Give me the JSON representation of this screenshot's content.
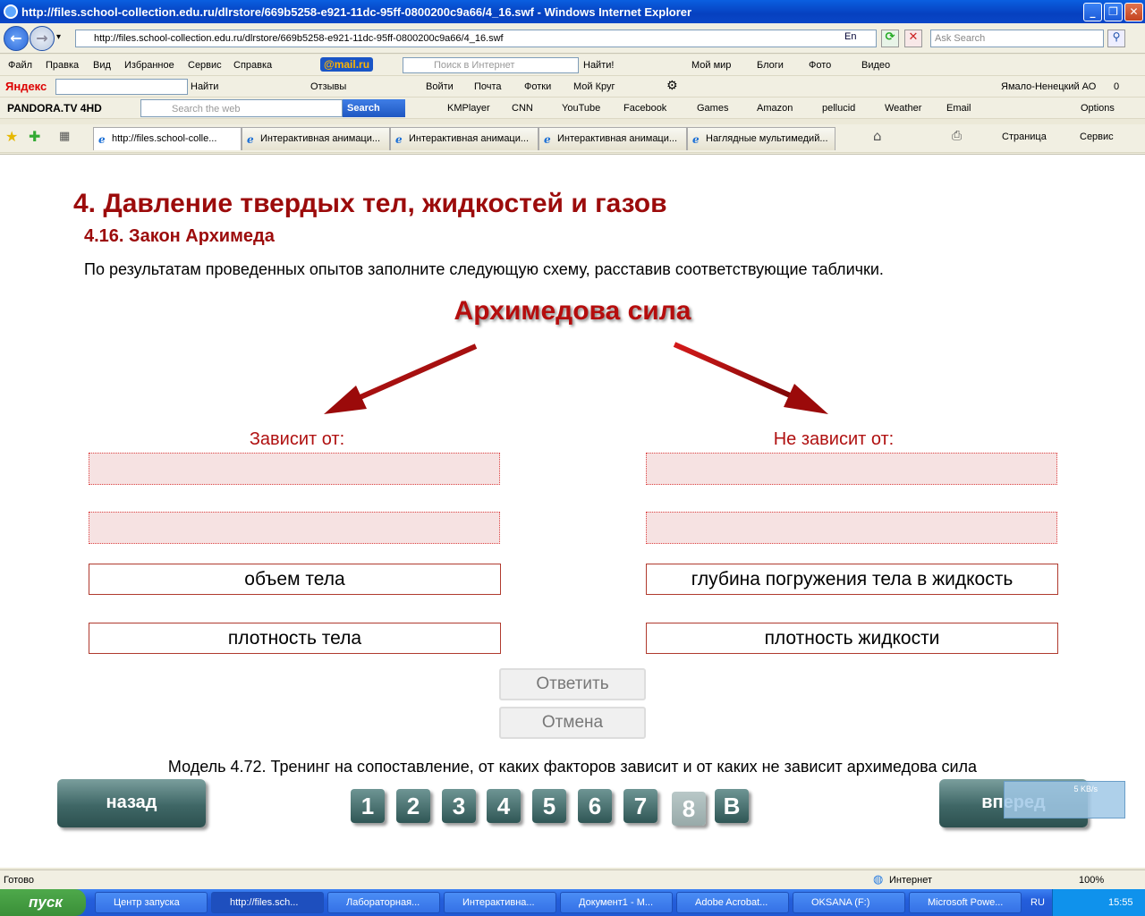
{
  "window": {
    "title": "http://files.school-collection.edu.ru/dlrstore/669b5258-e921-11dc-95ff-0800200c9a66/4_16.swf - Windows Internet Explorer"
  },
  "address": {
    "url": "http://files.school-collection.edu.ru/dlrstore/669b5258-e921-11dc-95ff-0800200c9a66/4_16.swf",
    "lang": "En",
    "ask_placeholder": "Ask Search"
  },
  "menu": [
    "Файл",
    "Правка",
    "Вид",
    "Избранное",
    "Сервис",
    "Справка"
  ],
  "mailbar": {
    "brand": "@mail.ru",
    "search_placeholder": "Поиск в Интернет",
    "find": "Найти!",
    "items": [
      "Мой мир",
      "Блоги",
      "Фото",
      "Видео"
    ]
  },
  "yandex": {
    "brand": "Яндекс",
    "find": "Найти",
    "reviews": "Отзывы",
    "items": [
      "Войти",
      "Почта",
      "Фотки",
      "Мой Круг"
    ],
    "region": "Ямало-Ненецкий АО",
    "count": "0"
  },
  "pandora": {
    "brand": "PANDORA.TV 4HD",
    "search_placeholder": "Search the web",
    "search_button": "Search",
    "items": [
      "KMPlayer",
      "CNN",
      "YouTube",
      "Facebook",
      "Games",
      "Amazon",
      "pellucid",
      "Weather",
      "Email"
    ],
    "options": "Options"
  },
  "tabs": [
    "http://files.school-colle...",
    "Интерактивная анимаци...",
    "Интерактивная анимаци...",
    "Интерактивная анимаци...",
    "Наглядные мультимедий..."
  ],
  "cmdbar": {
    "page": "Страница",
    "tools": "Сервис"
  },
  "content": {
    "title": "4. Давление твердых тел, жидкостей и газов",
    "subtitle": "4.16. Закон Архимеда",
    "instruction": "По результатам проведенных опытов заполните следующую схему, расставив соответствующие таблички.",
    "center_title": "Архимедова сила",
    "left_header": "Зависит от:",
    "right_header": "Не зависит от:",
    "cards_left": [
      "объем тела",
      "плотность тела"
    ],
    "cards_right": [
      "глубина погружения тела в жидкость",
      "плотность жидкости"
    ],
    "answer": "Ответить",
    "cancel": "Отмена",
    "caption": "Модель 4.72. Тренинг на сопоставление, от каких факторов зависит и от каких не зависит архимедова сила",
    "back": "назад",
    "forward": "вперед",
    "pages": [
      "1",
      "2",
      "3",
      "4",
      "5",
      "6",
      "7",
      "8",
      "В"
    ],
    "net_speed": "5 KB/s"
  },
  "status": {
    "left": "Готово",
    "zone": "Интернет",
    "zoom": "100%"
  },
  "taskbar": {
    "start": "пуск",
    "tasks": [
      "Центр запуска",
      "http://files.sch...",
      "Лабораторная...",
      "Интерактивна...",
      "Документ1 - М...",
      "Adobe Acrobat...",
      "OKSANA (F:)",
      "Microsoft Powe..."
    ],
    "lang": "RU",
    "time": "15:55"
  }
}
